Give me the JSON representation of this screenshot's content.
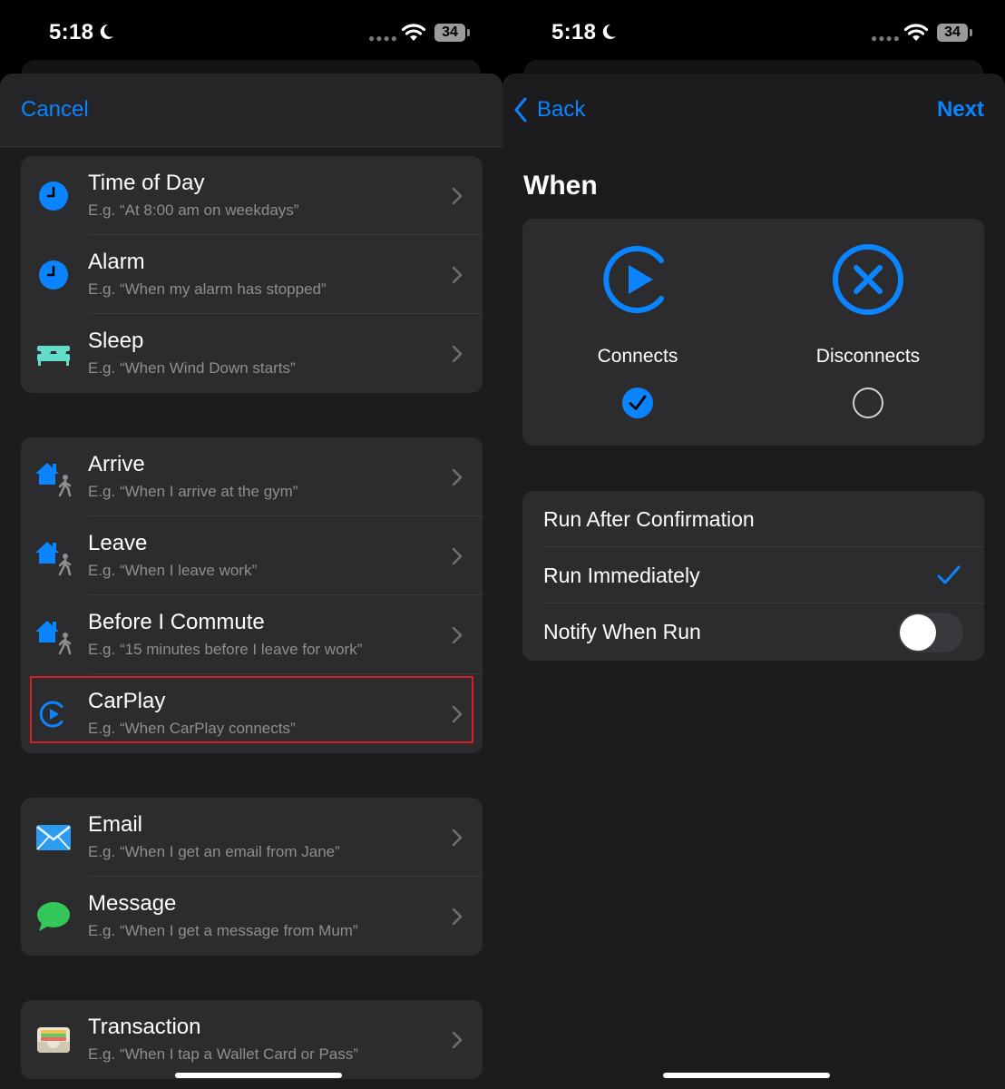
{
  "status_bar": {
    "time": "5:18",
    "battery": "34"
  },
  "left_screen": {
    "cancel_label": "Cancel",
    "groups": [
      [
        {
          "title": "Time of Day",
          "subtitle": "E.g. “At 8:00 am on weekdays”",
          "icon": "clock-icon"
        },
        {
          "title": "Alarm",
          "subtitle": "E.g. “When my alarm has stopped”",
          "icon": "clock-icon"
        },
        {
          "title": "Sleep",
          "subtitle": "E.g. “When Wind Down starts”",
          "icon": "bed-icon"
        }
      ],
      [
        {
          "title": "Arrive",
          "subtitle": "E.g. “When I arrive at the gym”",
          "icon": "home-walk-icon"
        },
        {
          "title": "Leave",
          "subtitle": "E.g. “When I leave work”",
          "icon": "home-walk-icon"
        },
        {
          "title": "Before I Commute",
          "subtitle": "E.g. “15 minutes before I leave for work”",
          "icon": "home-walk-icon"
        },
        {
          "title": "CarPlay",
          "subtitle": "E.g. “When CarPlay connects”",
          "icon": "carplay-icon"
        }
      ],
      [
        {
          "title": "Email",
          "subtitle": "E.g. “When I get an email from Jane”",
          "icon": "mail-icon"
        },
        {
          "title": "Message",
          "subtitle": "E.g. “When I get a message from Mum”",
          "icon": "message-icon"
        }
      ],
      [
        {
          "title": "Transaction",
          "subtitle": "E.g. “When I tap a Wallet Card or Pass”",
          "icon": "wallet-icon"
        }
      ]
    ]
  },
  "right_screen": {
    "back_label": "Back",
    "next_label": "Next",
    "section_title": "When",
    "options": [
      {
        "label": "Connects",
        "selected": true
      },
      {
        "label": "Disconnects",
        "selected": false
      }
    ],
    "settings": [
      {
        "label": "Run After Confirmation"
      },
      {
        "label": "Run Immediately",
        "checked": true
      },
      {
        "label": "Notify When Run",
        "toggle_on": false
      }
    ]
  },
  "colors": {
    "accent": "#0a84ff",
    "highlight": "#d5202b",
    "card": "#2c2c2e",
    "sheet": "#1c1c1e"
  }
}
